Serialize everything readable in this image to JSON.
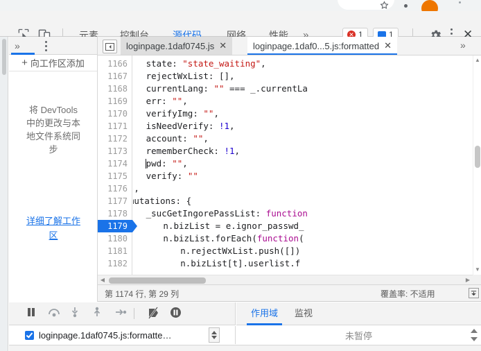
{
  "browser": {
    "icons": [
      "star-icon",
      "extensions-icon",
      "profile-avatar",
      "chrome-menu-icon"
    ]
  },
  "devtools_toolbar": {
    "inspect_icon": "inspect-element-icon",
    "device_icon": "device-toolbar-icon",
    "tabs": [
      {
        "label": "元素",
        "active": false
      },
      {
        "label": "控制台",
        "active": false
      },
      {
        "label": "源代码",
        "active": true
      },
      {
        "label": "网络",
        "active": false
      },
      {
        "label": "性能",
        "active": false
      }
    ],
    "more_label": "»",
    "error_count": "1",
    "message_count": "1",
    "settings_icon": "gear-icon",
    "menu_icon": "kebab-menu-icon",
    "close_icon": "close-icon"
  },
  "navigator": {
    "more_label": "»",
    "menu_icon": "kebab-menu-icon",
    "add_workspace_label": "向工作区添加",
    "add_plus": "+",
    "description": "将 DevTools 中的更改与本地文件系统同步",
    "link_label": "详细了解工作区"
  },
  "editor_tabs": {
    "collapse_icon": "collapse-sidebar-icon",
    "tabs": [
      {
        "label": "loginpage.1daf0745.js",
        "active": false,
        "close": "✕"
      },
      {
        "label": "loginpage.1daf0...5.js:formatted",
        "active": true,
        "close": "✕"
      }
    ],
    "more_label": "»"
  },
  "editor": {
    "first_line": 1166,
    "current_line": 1179,
    "line_count": 17,
    "lines": [
      {
        "n": 1166,
        "indent": 28,
        "tokens": [
          {
            "t": "state: ",
            "c": "plain"
          },
          {
            "t": "\"state_waiting\"",
            "c": "str"
          },
          {
            "t": ",",
            "c": "plain"
          }
        ]
      },
      {
        "n": 1167,
        "indent": 28,
        "tokens": [
          {
            "t": "rejectWxList: [],",
            "c": "plain"
          }
        ]
      },
      {
        "n": 1168,
        "indent": 28,
        "tokens": [
          {
            "t": "currentLang: ",
            "c": "plain"
          },
          {
            "t": "\"\"",
            "c": "str"
          },
          {
            "t": " === _.currentLa",
            "c": "plain"
          }
        ]
      },
      {
        "n": 1169,
        "indent": 28,
        "tokens": [
          {
            "t": "err: ",
            "c": "plain"
          },
          {
            "t": "\"\"",
            "c": "str"
          },
          {
            "t": ",",
            "c": "plain"
          }
        ]
      },
      {
        "n": 1170,
        "indent": 28,
        "tokens": [
          {
            "t": "verifyImg: ",
            "c": "plain"
          },
          {
            "t": "\"\"",
            "c": "str"
          },
          {
            "t": ",",
            "c": "plain"
          }
        ]
      },
      {
        "n": 1171,
        "indent": 28,
        "tokens": [
          {
            "t": "isNeedVerify: ",
            "c": "plain"
          },
          {
            "t": "!1",
            "c": "num"
          },
          {
            "t": ",",
            "c": "plain"
          }
        ]
      },
      {
        "n": 1172,
        "indent": 28,
        "tokens": [
          {
            "t": "account: ",
            "c": "plain"
          },
          {
            "t": "\"\"",
            "c": "str"
          },
          {
            "t": ",",
            "c": "plain"
          }
        ]
      },
      {
        "n": 1173,
        "indent": 28,
        "tokens": [
          {
            "t": "rememberCheck: ",
            "c": "plain"
          },
          {
            "t": "!1",
            "c": "num"
          },
          {
            "t": ",",
            "c": "plain"
          }
        ]
      },
      {
        "n": 1174,
        "indent": 28,
        "tokens": [
          {
            "t": "pwd: ",
            "c": "plain"
          },
          {
            "t": "\"\"",
            "c": "str"
          },
          {
            "t": ",",
            "c": "plain"
          }
        ]
      },
      {
        "n": 1175,
        "indent": 28,
        "tokens": [
          {
            "t": "verify: ",
            "c": "plain"
          },
          {
            "t": "\"\"",
            "c": "str"
          }
        ]
      },
      {
        "n": 1176,
        "indent": 24,
        "tokens": [
          {
            "t": "},",
            "c": "plain"
          }
        ]
      },
      {
        "n": 1177,
        "indent": 24,
        "tokens": [
          {
            "t": "mutations: {",
            "c": "plain"
          }
        ]
      },
      {
        "n": 1178,
        "indent": 28,
        "tokens": [
          {
            "t": "_sucGetIngorePassList: ",
            "c": "plain"
          },
          {
            "t": "function",
            "c": "kw"
          }
        ]
      },
      {
        "n": 1179,
        "indent": 32,
        "tokens": [
          {
            "t": "n.bizList = e.ignor_passwd_",
            "c": "plain"
          }
        ]
      },
      {
        "n": 1180,
        "indent": 32,
        "tokens": [
          {
            "t": "n.bizList.forEach(",
            "c": "plain"
          },
          {
            "t": "function",
            "c": "kw"
          },
          {
            "t": "(",
            "c": "plain"
          }
        ]
      },
      {
        "n": 1181,
        "indent": 36,
        "tokens": [
          {
            "t": "n.rejectWxList.push([])",
            "c": "plain"
          }
        ]
      },
      {
        "n": 1182,
        "indent": 36,
        "tokens": [
          {
            "t": "n.bizList[t].userlist.f",
            "c": "plain"
          }
        ]
      }
    ]
  },
  "status_bar": {
    "position": "第 1174 行, 第 29 列",
    "coverage": "覆盖率: 不适用",
    "toggle_icon": "toggle-drawer-icon"
  },
  "debugger": {
    "controls": [
      "pause-icon",
      "step-over-icon",
      "step-into-icon",
      "step-out-icon",
      "step-icon",
      "deactivate-breakpoints-icon",
      "pause-on-exceptions-icon"
    ],
    "tabs": [
      {
        "label": "作用域",
        "active": true
      },
      {
        "label": "监视",
        "active": false
      }
    ],
    "breakpoint_file": "loginpage.1daf0745.js:formatte…",
    "breakpoint_checked": true,
    "scope_message": "未暂停"
  },
  "colors": {
    "accent": "#1a73e8",
    "error": "#d93025",
    "string": "#c41a16",
    "keyword": "#aa0d91",
    "number": "#1c00cf"
  }
}
